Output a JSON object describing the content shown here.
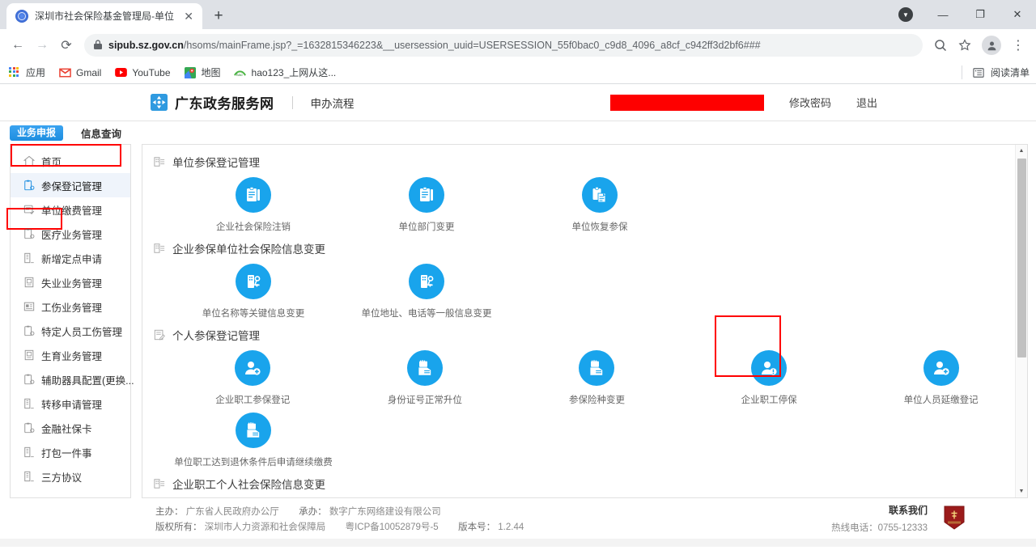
{
  "browser": {
    "tab": {
      "title": "深圳市社会保险基金管理局-单位",
      "close_label": "✕",
      "favicon": "globe-icon"
    },
    "new_tab_label": "+",
    "window": {
      "minimize": "—",
      "maximize": "❐",
      "close": "✕",
      "download_chip": "▼"
    },
    "nav": {
      "back": "←",
      "forward": "→",
      "reload": "⟳"
    },
    "omnibox": {
      "lock": "🔒",
      "url_domain": "sipub.sz.gov.cn",
      "url_path": "/hsoms/mainFrame.jsp?_=1632815346223&__usersession_uuid=USERSESSION_55f0bac0_c9d8_4096_a8cf_c942ff3d2bf6###"
    },
    "toolbar_right": {
      "zoom": "⌕",
      "bookmark": "☆",
      "profile": "👤",
      "menu": "⋮"
    },
    "bookmarks": [
      {
        "label": "应用",
        "icon": "apps-grid-icon"
      },
      {
        "label": "Gmail",
        "icon": "gmail-icon"
      },
      {
        "label": "YouTube",
        "icon": "youtube-icon"
      },
      {
        "label": "地图",
        "icon": "maps-icon"
      },
      {
        "label": "hao123_上网从这...",
        "icon": "hao123-icon"
      }
    ],
    "reading_list": {
      "label": "阅读清单",
      "icon": "reading-list-icon"
    }
  },
  "site": {
    "brand": "广东政务服务网",
    "brand_sub": "申办流程",
    "user_redacted": "",
    "links": [
      {
        "label": "修改密码"
      },
      {
        "label": "退出"
      }
    ],
    "tabs": [
      {
        "label": "业务申报",
        "active": true
      },
      {
        "label": "信息查询",
        "active": false
      }
    ]
  },
  "sidebar": {
    "items": [
      {
        "label": "首页",
        "icon": "home-icon",
        "active": false
      },
      {
        "label": "参保登记管理",
        "icon": "clipboard-gear-icon",
        "active": true
      },
      {
        "label": "单位缴费管理",
        "icon": "form-check-icon",
        "active": false
      },
      {
        "label": "医疗业务管理",
        "icon": "clipboard-gear-icon",
        "active": false
      },
      {
        "label": "新增定点申请",
        "icon": "building-icon",
        "active": false
      },
      {
        "label": "失业业务管理",
        "icon": "document-icon",
        "active": false
      },
      {
        "label": "工伤业务管理",
        "icon": "card-icon",
        "active": false
      },
      {
        "label": "特定人员工伤管理",
        "icon": "clipboard-gear-icon",
        "active": false
      },
      {
        "label": "生育业务管理",
        "icon": "document-icon",
        "active": false
      },
      {
        "label": "辅助器具配置(更换...",
        "icon": "clipboard-gear-icon",
        "active": false
      },
      {
        "label": "转移申请管理",
        "icon": "building-icon",
        "active": false
      },
      {
        "label": "金融社保卡",
        "icon": "clipboard-gear-icon",
        "active": false
      },
      {
        "label": "打包一件事",
        "icon": "building-icon",
        "active": false
      },
      {
        "label": "三方协议",
        "icon": "building-icon",
        "active": false
      }
    ]
  },
  "content": {
    "groups": [
      {
        "title": "单位参保登记管理",
        "icon": "building-list-icon",
        "tiles": [
          {
            "label": "企业社会保险注销",
            "icon": "clipboard-icon",
            "highlighted": false
          },
          {
            "label": "单位部门变更",
            "icon": "clipboard-icon",
            "highlighted": false
          },
          {
            "label": "单位恢复参保",
            "icon": "clipboard-copy-icon",
            "highlighted": false
          }
        ]
      },
      {
        "title": "企业参保单位社会保险信息变更",
        "icon": "building-list-icon",
        "tiles": [
          {
            "label": "单位名称等关键信息变更",
            "icon": "building-key-icon",
            "highlighted": false
          },
          {
            "label": "单位地址、电话等一般信息变更",
            "icon": "building-key-icon",
            "highlighted": false
          }
        ]
      },
      {
        "title": "个人参保登记管理",
        "icon": "document-edit-icon",
        "tiles": [
          {
            "label": "企业职工参保登记",
            "icon": "user-plus-icon",
            "highlighted": false
          },
          {
            "label": "身份证号正常升位",
            "icon": "hand-card-icon",
            "highlighted": false
          },
          {
            "label": "参保险种变更",
            "icon": "hand-card-icon",
            "highlighted": false
          },
          {
            "label": "企业职工停保",
            "icon": "user-minus-icon",
            "highlighted": true
          },
          {
            "label": "单位人员延缴登记",
            "icon": "user-plus-icon",
            "highlighted": false
          }
        ]
      },
      {
        "title": "",
        "icon": "",
        "tiles": [
          {
            "label": "单位职工达到退休条件后申请继续缴费",
            "icon": "hand-card-icon",
            "highlighted": false
          }
        ]
      },
      {
        "title": "企业职工个人社会保险信息变更",
        "icon": "building-list-icon",
        "tiles": []
      }
    ],
    "scrollbar": {
      "up": "▲",
      "down": "▼"
    }
  },
  "footer": {
    "line1_label_a": "主办：",
    "line1_value_a": "广东省人民政府办公厅",
    "line1_label_b": "承办：",
    "line1_value_b": "数字广东网络建设有限公司",
    "line2_label": "版权所有：",
    "line2_value": "深圳市人力资源和社会保障局",
    "icp": "粤ICP备10052879号-5",
    "version_label": "版本号：",
    "version": "1.2.44",
    "contact_title": "联系我们",
    "hotline": "热线电话：0755-12333",
    "seal": "gov-seal-icon"
  },
  "colors": {
    "accent_blue": "#19a4ec",
    "tab_blue": "#1e8ee0",
    "highlight_red": "#ff0000",
    "sidebar_active_bg": "#eff4fb"
  }
}
